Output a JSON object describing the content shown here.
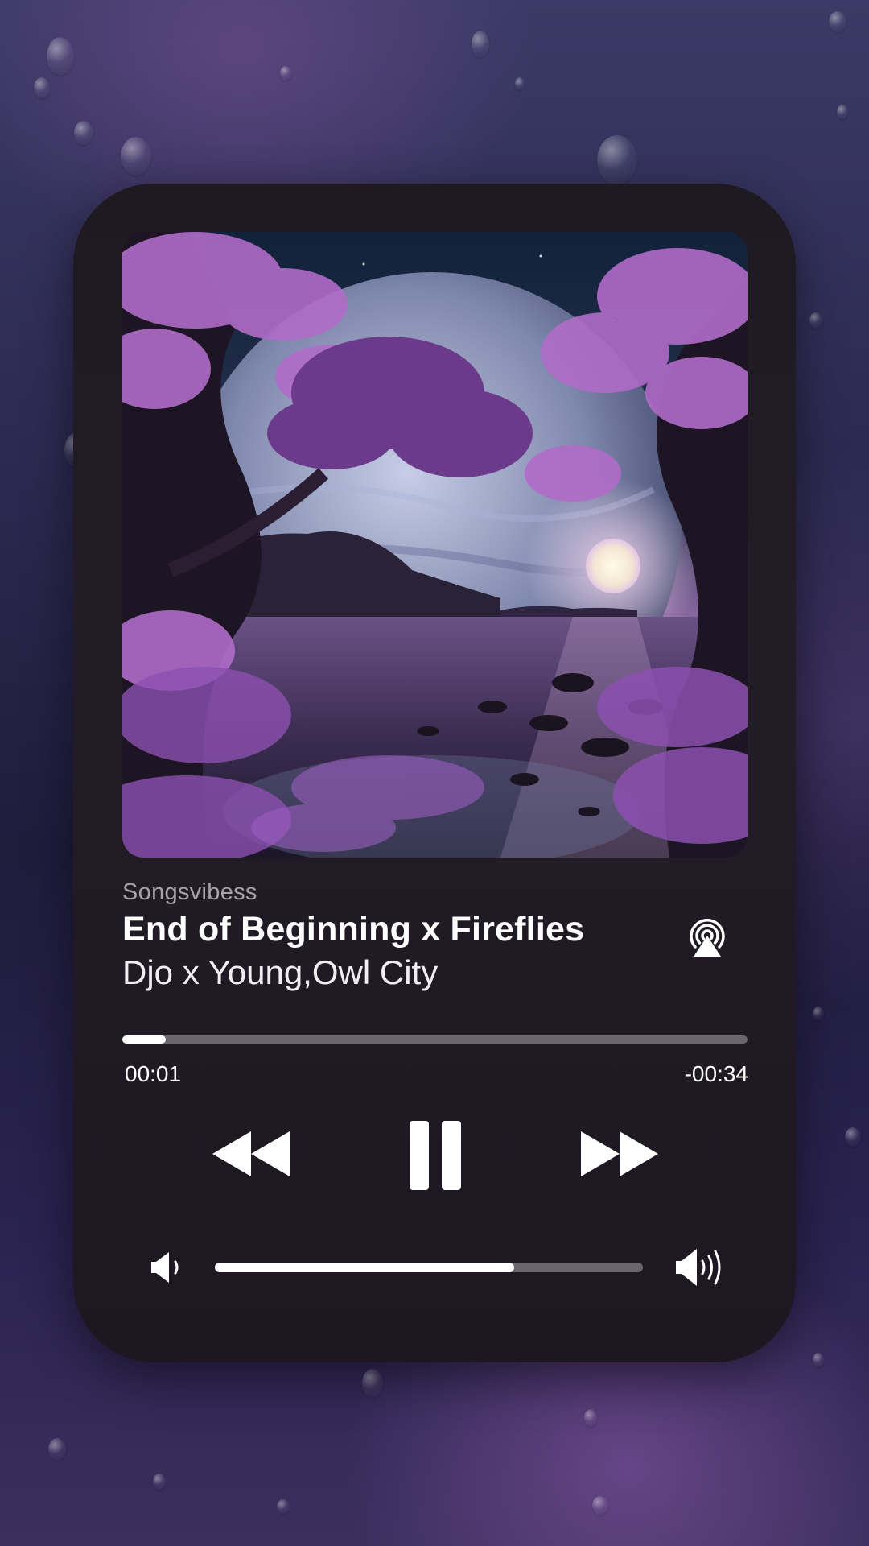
{
  "player": {
    "source": "Songsvibess",
    "title": "End of Beginning x Fireflies",
    "artist": "Djo x Young,Owl City",
    "elapsed": "00:01",
    "remaining": "-00:34",
    "progress_fraction": 0.07,
    "volume_fraction": 0.7
  },
  "icons": {
    "airplay": "airplay-icon",
    "rewind": "rewind-icon",
    "pause": "pause-icon",
    "fast_forward": "fast-forward-icon",
    "volume_low": "volume-low-icon",
    "volume_high": "volume-high-icon"
  },
  "colors": {
    "card_bg": "#201a24",
    "track": "#6b666d",
    "fill": "#ffffff",
    "accent_purple": "#b470d8"
  }
}
